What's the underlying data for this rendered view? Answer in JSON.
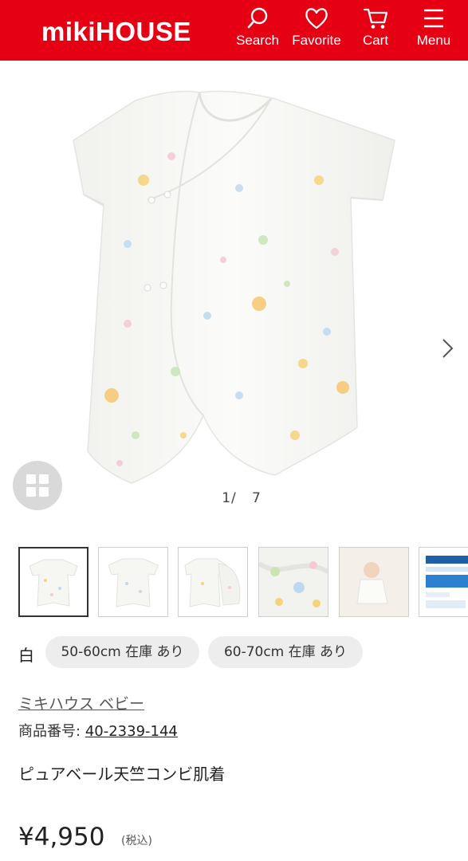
{
  "header": {
    "logo": "mikiHOUSE",
    "nav": [
      {
        "label": "Search",
        "icon": "search-icon"
      },
      {
        "label": "Favorite",
        "icon": "heart-icon"
      },
      {
        "label": "Cart",
        "icon": "cart-icon"
      },
      {
        "label": "Menu",
        "icon": "hamburger-icon"
      }
    ],
    "bg_color": "#e60013"
  },
  "gallery": {
    "current": "1",
    "separator": "/",
    "total": "7",
    "thumbnails": [
      {
        "desc": "front",
        "active": true
      },
      {
        "desc": "back",
        "active": false
      },
      {
        "desc": "open",
        "active": false
      },
      {
        "desc": "fabric-closeup",
        "active": false
      },
      {
        "desc": "baby-wearing",
        "active": false
      },
      {
        "desc": "package",
        "active": false
      }
    ]
  },
  "product": {
    "color": "白",
    "sizes": [
      "50-60cm 在庫 あり",
      "60-70cm 在庫 あり"
    ],
    "brand": "ミキハウス ベビー",
    "item_no_label": "商品番号:",
    "item_no": "40-2339-144",
    "name": "ピュアベール天竺コンビ肌着",
    "price": "¥4,950",
    "tax_note": "(税込)"
  }
}
